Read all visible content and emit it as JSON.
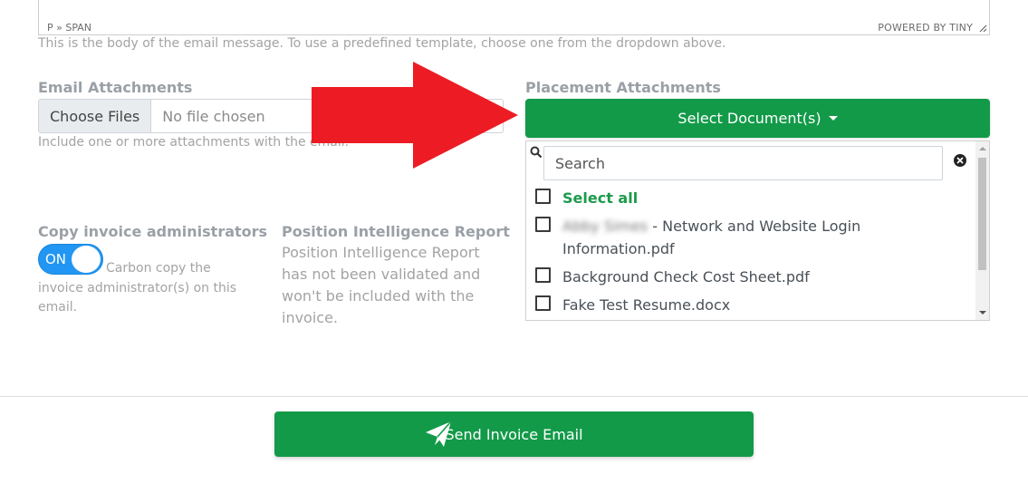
{
  "editor": {
    "path": "P » SPAN",
    "powered_by": "POWERED BY TINY"
  },
  "body_help": "This is the body of the email message. To use a predefined template, choose one from the dropdown above.",
  "email_attachments": {
    "label": "Email Attachments",
    "choose_button": "Choose Files",
    "status": "No file chosen",
    "help": "Include one or more attachments with the email."
  },
  "placement_attachments": {
    "label": "Placement Attachments",
    "select_button": "Select Document(s)",
    "search_placeholder": "Search",
    "select_all": "Select all",
    "options": [
      {
        "name_blurred": "Abby Simes",
        "line1": " - Network and Website Login",
        "line2": "Information.pdf"
      },
      {
        "label": "Background Check Cost Sheet.pdf"
      },
      {
        "label": "Fake Test Resume.docx"
      }
    ]
  },
  "copy_admins": {
    "label": "Copy invoice administrators",
    "toggle": "ON",
    "line1": "Carbon copy the",
    "line2": "invoice administrator(s) on this",
    "line3": "email."
  },
  "position_report": {
    "label": "Position Intelligence Report",
    "lines": [
      "Position Intelligence Report",
      "has not been validated and",
      "won't be included with the",
      "invoice."
    ]
  },
  "send_button": {
    "label": "Send Invoice Email"
  },
  "colors": {
    "primary_green": "#129a48",
    "toggle_blue": "#2196f3",
    "arrow_red": "#ed1c24"
  },
  "icons": [
    "search-icon",
    "close-circle-icon",
    "paper-plane-icon",
    "caret-down-icon",
    "resize-grip-icon"
  ]
}
